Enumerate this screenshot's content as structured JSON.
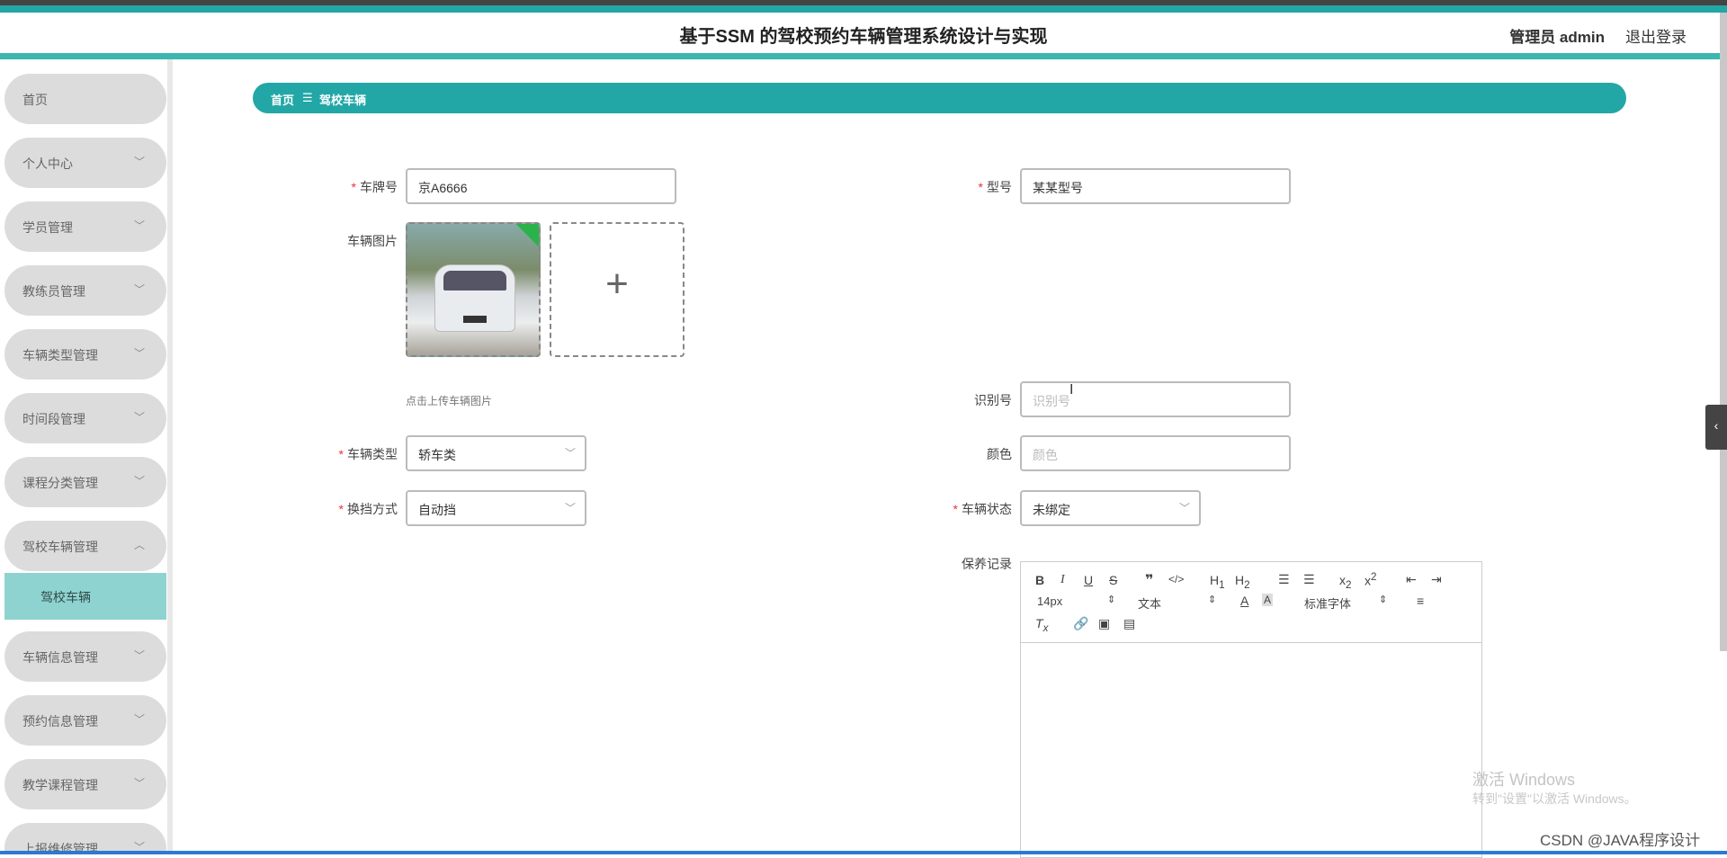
{
  "header": {
    "title": "基于SSM 的驾校预约车辆管理系统设计与实现",
    "admin": "管理员 admin",
    "logout": "退出登录"
  },
  "sidebar": {
    "items": [
      {
        "label": "首页"
      },
      {
        "label": "个人中心"
      },
      {
        "label": "学员管理"
      },
      {
        "label": "教练员管理"
      },
      {
        "label": "车辆类型管理"
      },
      {
        "label": "时间段管理"
      },
      {
        "label": "课程分类管理"
      },
      {
        "label": "驾校车辆管理"
      },
      {
        "label": "车辆信息管理"
      },
      {
        "label": "预约信息管理"
      },
      {
        "label": "教学课程管理"
      },
      {
        "label": "上报维修管理"
      }
    ],
    "active_sub": "驾校车辆"
  },
  "breadcrumb": {
    "home": "首页",
    "sep": "☰",
    "current": "驾校车辆"
  },
  "form": {
    "plate": {
      "label": "车牌号",
      "value": "京A6666"
    },
    "model": {
      "label": "型号",
      "value": "某某型号"
    },
    "image": {
      "label": "车辆图片",
      "hint": "点击上传车辆图片",
      "add": "+"
    },
    "vin": {
      "label": "识别号",
      "placeholder": "识别号"
    },
    "vehicle_type": {
      "label": "车辆类型",
      "value": "轿车类"
    },
    "color": {
      "label": "颜色",
      "placeholder": "颜色"
    },
    "gear": {
      "label": "换挡方式",
      "value": "自动挡"
    },
    "status": {
      "label": "车辆状态",
      "value": "未绑定"
    },
    "maintenance": {
      "label": "保养记录"
    }
  },
  "editor": {
    "font_size": "14px",
    "format": "文本",
    "font_family": "标准字体"
  },
  "overlay": {
    "activate_title": "激活 Windows",
    "activate_sub": "转到\"设置\"以激活 Windows。",
    "csdn": "CSDN @JAVA程序设计"
  }
}
